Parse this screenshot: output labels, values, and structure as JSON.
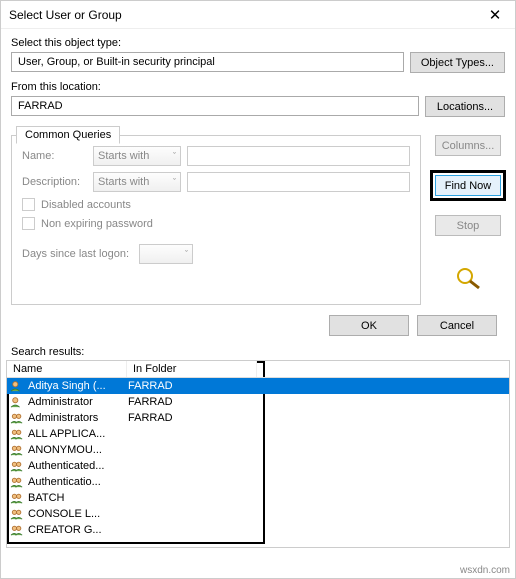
{
  "window": {
    "title": "Select User or Group"
  },
  "objectType": {
    "label": "Select this object type:",
    "value": "User, Group, or Built-in security principal",
    "button": "Object Types..."
  },
  "location": {
    "label": "From this location:",
    "value": "FARRAD",
    "button": "Locations..."
  },
  "commonQueries": {
    "tab": "Common Queries",
    "nameLabel": "Name:",
    "nameMode": "Starts with",
    "descLabel": "Description:",
    "descMode": "Starts with",
    "disabledAccounts": "Disabled accounts",
    "nonExpiring": "Non expiring password",
    "daysSince": "Days since last logon:"
  },
  "sideButtons": {
    "columns": "Columns...",
    "findNow": "Find Now",
    "stop": "Stop"
  },
  "buttons": {
    "ok": "OK",
    "cancel": "Cancel"
  },
  "results": {
    "label": "Search results:",
    "headers": {
      "name": "Name",
      "folder": "In Folder"
    },
    "rows": [
      {
        "name": "Aditya Singh (...",
        "folder": "FARRAD",
        "icon": "user",
        "selected": true
      },
      {
        "name": "Administrator",
        "folder": "FARRAD",
        "icon": "user"
      },
      {
        "name": "Administrators",
        "folder": "FARRAD",
        "icon": "group"
      },
      {
        "name": "ALL APPLICA...",
        "folder": "",
        "icon": "group"
      },
      {
        "name": "ANONYMOU...",
        "folder": "",
        "icon": "group"
      },
      {
        "name": "Authenticated...",
        "folder": "",
        "icon": "group"
      },
      {
        "name": "Authenticatio...",
        "folder": "",
        "icon": "group"
      },
      {
        "name": "BATCH",
        "folder": "",
        "icon": "group"
      },
      {
        "name": "CONSOLE L...",
        "folder": "",
        "icon": "group"
      },
      {
        "name": "CREATOR G...",
        "folder": "",
        "icon": "group"
      }
    ]
  },
  "watermark": "wsxdn.com"
}
